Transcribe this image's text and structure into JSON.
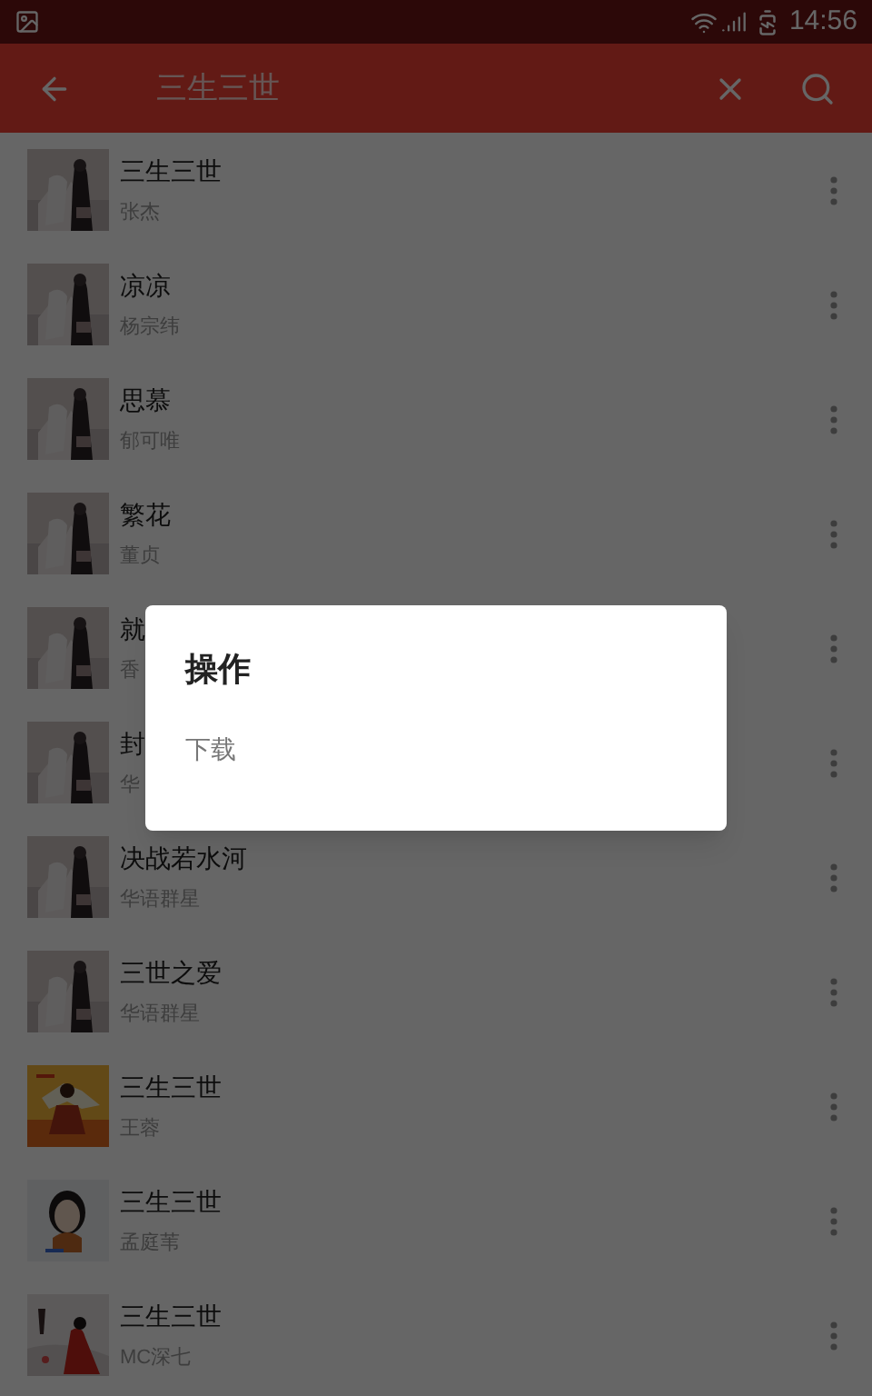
{
  "status_bar": {
    "time": "14:56"
  },
  "toolbar": {
    "search": {
      "value": "三生三世"
    }
  },
  "songs": [
    {
      "title": "三生三世",
      "artist": "张杰"
    },
    {
      "title": "凉凉",
      "artist": "杨宗纬"
    },
    {
      "title": "思慕",
      "artist": "郁可唯"
    },
    {
      "title": "繁花",
      "artist": "董贞"
    },
    {
      "title": "就",
      "artist": "香"
    },
    {
      "title": "封",
      "artist": "华"
    },
    {
      "title": "决战若水河",
      "artist": "华语群星"
    },
    {
      "title": "三世之爱",
      "artist": "华语群星"
    },
    {
      "title": "三生三世",
      "artist": "王蓉"
    },
    {
      "title": "三生三世",
      "artist": "孟庭苇"
    },
    {
      "title": "三生三世",
      "artist": "MC深七"
    }
  ],
  "dialog": {
    "title": "操作",
    "options": [
      "下载"
    ]
  }
}
